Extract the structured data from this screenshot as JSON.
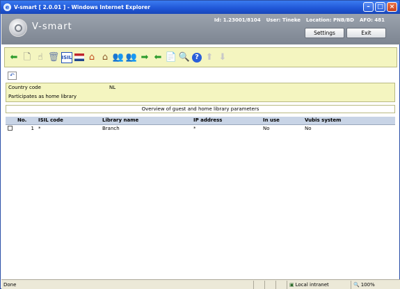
{
  "window": {
    "title": "V-smart [ 2.0.01 ] - Windows Internet Explorer",
    "icon": "ie-icon"
  },
  "header": {
    "brand": "V-smart",
    "id_label": "Id: 1.23001/8104",
    "user_label": "User: Tineke",
    "location_label": "Location: PNB/BD",
    "afo_label": "AFO: 481",
    "settings_label": "Settings",
    "exit_label": "Exit"
  },
  "toolbar": {
    "icons": [
      "back-arrow-icon",
      "new-document-icon",
      "hand-select-icon",
      "trash-icon",
      "isil-icon",
      "flag-icon",
      "house-icon",
      "house-alt-icon",
      "users-icon",
      "users-settings-icon",
      "arrow-right-icon",
      "arrow-left-icon",
      "document-list-icon",
      "document-search-icon",
      "help-icon",
      "up-arrow-icon",
      "down-arrow-icon"
    ]
  },
  "panel": {
    "country_code_label": "Country code",
    "country_code_value": "NL",
    "participates_label": "Participates as home library"
  },
  "overview_title": "Overview of guest and home library parameters",
  "table": {
    "columns": [
      "No.",
      "ISIL code",
      "Library name",
      "IP address",
      "In use",
      "Vubis system"
    ],
    "rows": [
      {
        "no": "1",
        "isil": "*",
        "library": "Branch",
        "ip": "*",
        "in_use": "No",
        "vubis": "No"
      }
    ]
  },
  "statusbar": {
    "status": "Done",
    "zone": "Local intranet",
    "zoom": "100%"
  },
  "colors": {
    "toolbar_bg": "#f4f5c0",
    "header_bg": "#8a919c",
    "table_header_bg": "#c8d4e6",
    "titlebar": "#1f55d6"
  }
}
